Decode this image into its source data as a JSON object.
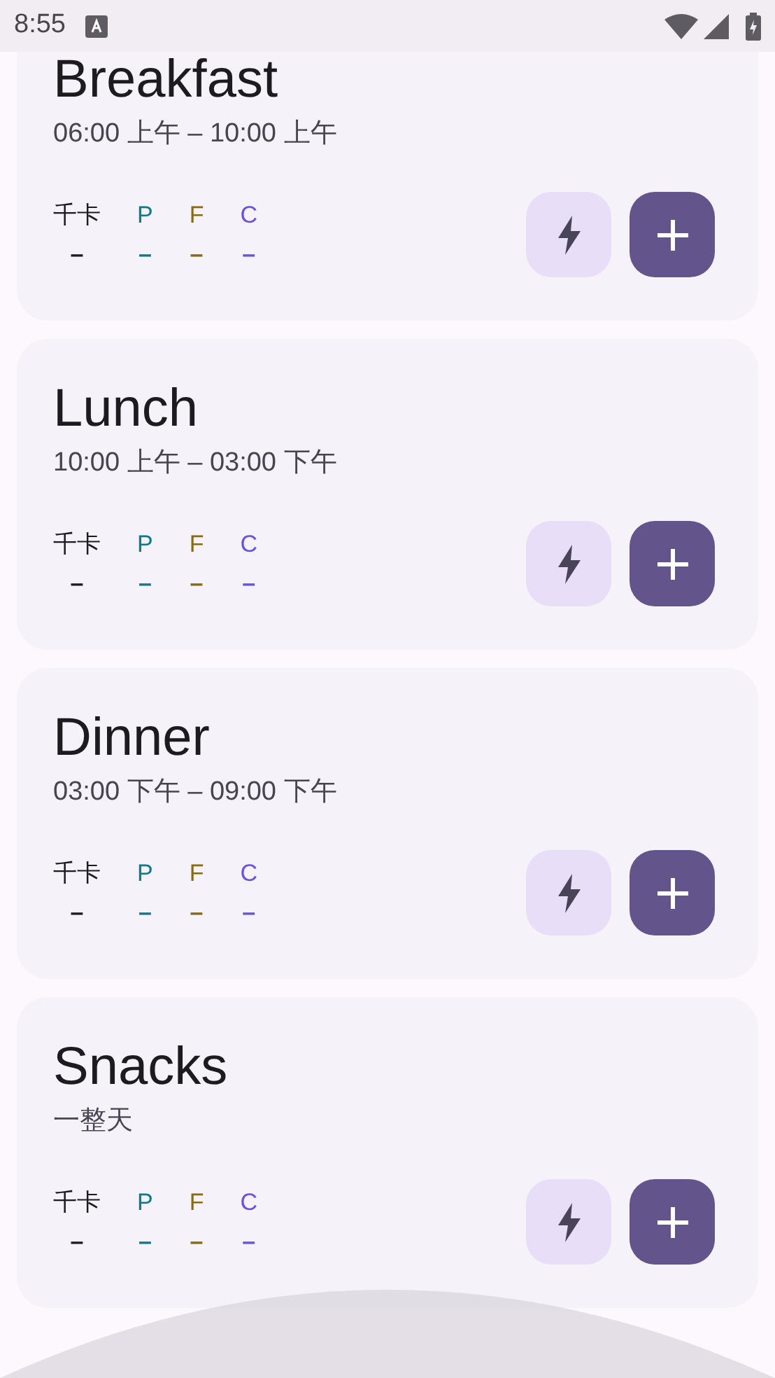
{
  "status_bar": {
    "time": "8:55"
  },
  "meals": [
    {
      "title": "Breakfast",
      "time": "06:00 上午 – 10:00 上午",
      "macros": [
        {
          "label": "千卡",
          "value": "–",
          "color": "#1d1b20"
        },
        {
          "label": "P",
          "value": "–",
          "color": "#0e7a8c"
        },
        {
          "label": "F",
          "value": "–",
          "color": "#876a12"
        },
        {
          "label": "C",
          "value": "–",
          "color": "#6b52dc"
        }
      ]
    },
    {
      "title": "Lunch",
      "time": "10:00 上午 – 03:00 下午",
      "macros": [
        {
          "label": "千卡",
          "value": "–",
          "color": "#1d1b20"
        },
        {
          "label": "P",
          "value": "–",
          "color": "#0e7a8c"
        },
        {
          "label": "F",
          "value": "–",
          "color": "#876a12"
        },
        {
          "label": "C",
          "value": "–",
          "color": "#6b52dc"
        }
      ]
    },
    {
      "title": "Dinner",
      "time": "03:00 下午 – 09:00 下午",
      "macros": [
        {
          "label": "千卡",
          "value": "–",
          "color": "#1d1b20"
        },
        {
          "label": "P",
          "value": "–",
          "color": "#0e7a8c"
        },
        {
          "label": "F",
          "value": "–",
          "color": "#876a12"
        },
        {
          "label": "C",
          "value": "–",
          "color": "#6b52dc"
        }
      ]
    },
    {
      "title": "Snacks",
      "time": "一整天",
      "macros": [
        {
          "label": "千卡",
          "value": "–",
          "color": "#1d1b20"
        },
        {
          "label": "P",
          "value": "–",
          "color": "#0e7a8c"
        },
        {
          "label": "F",
          "value": "–",
          "color": "#876a12"
        },
        {
          "label": "C",
          "value": "–",
          "color": "#6b52dc"
        }
      ]
    }
  ]
}
